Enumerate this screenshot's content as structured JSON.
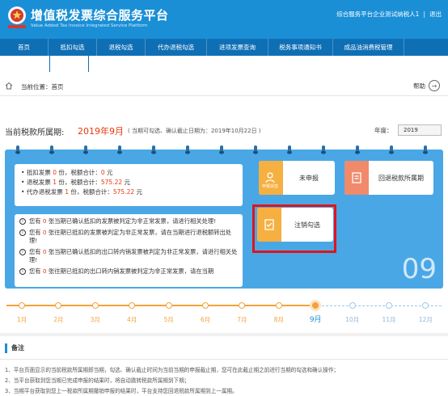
{
  "header": {
    "title": "增值税发票综合服务平台",
    "subtitle": "Value Added Tax Invoice Integrated Service Platform",
    "user": "综合服务平台企业测试纳税人1",
    "logout": "退出",
    "brand_color": "#1a8fd6"
  },
  "nav": {
    "items": [
      {
        "label": "首页"
      },
      {
        "label": "抵扣勾选"
      },
      {
        "label": "退税勾选"
      },
      {
        "label": "代办退税勾选"
      },
      {
        "label": "进项发票查询"
      },
      {
        "label": "税务事项通知书"
      },
      {
        "label": "成品油消费税管理"
      }
    ]
  },
  "breadcrumb": {
    "label": "当前位置：首页",
    "help": "帮助"
  },
  "period": {
    "label": "当前税款所属期:",
    "value": "2019年9月",
    "note": "( 当期可勾选、确认截止日期为：2019年10月22日 )",
    "year_label": "年度：",
    "year_value": "2019"
  },
  "stats": {
    "line1_a": "抵扣发票 ",
    "line1_count": "0",
    "line1_b": " 份，税额合计：",
    "line1_amount": "0",
    "line1_c": " 元",
    "line2_a": "退税发票 ",
    "line2_count": "1",
    "line2_b": " 份，税额合计：",
    "line2_amount": "575.22",
    "line2_c": " 元",
    "line3_a": "代办退税发票 ",
    "line3_count": "1",
    "line3_b": " 份，税额合计：",
    "line3_amount": "575.22",
    "line3_c": " 元"
  },
  "messages": [
    {
      "pre": "您有 ",
      "count": "0",
      "post": " 张当期已确认抵扣的发票被判定为非正常发票，请进行相关处理!"
    },
    {
      "pre": "您有 ",
      "count": "0",
      "post": " 张往期已抵扣的发票被判定为非正常发票，请在当期进行退税额转出处理!"
    },
    {
      "pre": "您有 ",
      "count": "0",
      "post": " 张当期已确认抵扣的出口转内销发票被判定为非正常发票，请进行相关处理!"
    },
    {
      "pre": "您有 ",
      "count": "0",
      "post": " 张往期已抵扣的出口转内销发票被判定为非正常发票，请在当期"
    }
  ],
  "tiles": {
    "declare_status": "未申报",
    "declare_sub": "申报状态",
    "back_period": "回退税款所属期",
    "cancel_check": "注销勾选"
  },
  "big_month": "09",
  "timeline": {
    "months": [
      "1月",
      "2月",
      "3月",
      "4月",
      "5月",
      "6月",
      "7月",
      "8月",
      "9月",
      "10月",
      "11月",
      "12月"
    ],
    "current_index": 8
  },
  "notes": {
    "title": "备注",
    "lines": [
      "1、平台页面显示的当前税款所属期即当期，勾选、确认截止时间为当前当期的申报截止期，您可在此截止期之前进行当期的勾选和确认操作；",
      "2、当平台获取到您当期已完成申报的结果时，将自动跳转税款所属期到下期；",
      "3、当期平台获取到您上一税款所属期撤销申报的结果时，平台支持您回退税款所属期到上一属期。"
    ]
  }
}
